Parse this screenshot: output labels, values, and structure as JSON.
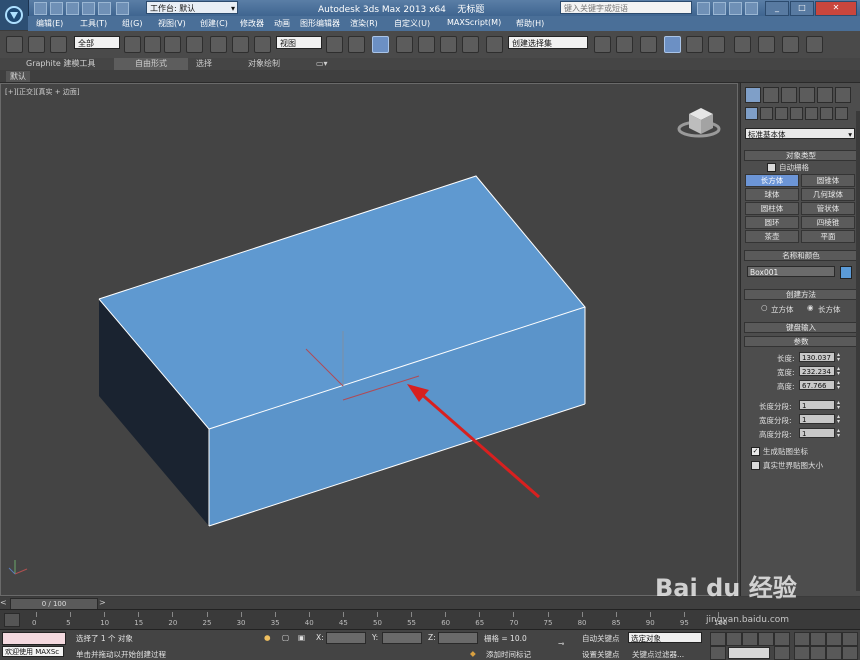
{
  "titlebar": {
    "workspace_prefix": "工作台:",
    "workspace_value": "默认",
    "app_title": "Autodesk 3ds Max  2013 x64",
    "file_name": "无标题",
    "search_placeholder": "键入关键字或短语"
  },
  "menu": {
    "items": [
      "编辑(E)",
      "工具(T)",
      "组(G)",
      "视图(V)",
      "创建(C)",
      "修改器",
      "动画",
      "图形编辑器",
      "渲染(R)",
      "自定义(U)",
      "MAXScript(M)",
      "帮助(H)"
    ]
  },
  "toolbar": {
    "filter_value": "全部",
    "coord_value": "视图",
    "selection_set": "创建选择集"
  },
  "ribbon": {
    "tabs": [
      "Graphite 建模工具",
      "自由形式",
      "选择",
      "对象绘制"
    ],
    "sub_label": "默认"
  },
  "viewport": {
    "label_parts": [
      "[+]",
      "[正交]",
      "[真实 + 边面]"
    ]
  },
  "cmdpanel": {
    "category": "标准基本体",
    "object_type": {
      "title": "对象类型",
      "autogrid": "自动栅格",
      "buttons": [
        "长方体",
        "圆锥体",
        "球体",
        "几何球体",
        "圆柱体",
        "管状体",
        "圆环",
        "四棱锥",
        "茶壶",
        "平面"
      ]
    },
    "name_color": {
      "title": "名称和颜色",
      "name": "Box001",
      "color": "#5b9bd8"
    },
    "creation_method": {
      "title": "创建方法",
      "options": [
        "立方体",
        "长方体"
      ]
    },
    "keyboard_entry": "键盘输入",
    "params": {
      "title": "参数",
      "length_label": "长度:",
      "length": "130.037",
      "width_label": "宽度:",
      "width": "232.234",
      "height_label": "高度:",
      "height": "67.766",
      "lseg_label": "长度分段:",
      "lseg": "1",
      "wseg_label": "宽度分段:",
      "wseg": "1",
      "hseg_label": "高度分段:",
      "hseg": "1",
      "gen_map": "生成贴图坐标",
      "real_world": "真实世界贴图大小"
    }
  },
  "timeline": {
    "frame_counter": "0 / 100",
    "ticks": [
      "0",
      "5",
      "10",
      "15",
      "20",
      "25",
      "30",
      "35",
      "40",
      "45",
      "50",
      "55",
      "60",
      "65",
      "70",
      "75",
      "80",
      "85",
      "90",
      "95",
      "100"
    ]
  },
  "status": {
    "welcome": "欢迎使用 MAXSc",
    "selected": "选择了 1 个 对象",
    "prompt": "单击并拖动以开始创建过程",
    "x_label": "X:",
    "y_label": "Y:",
    "z_label": "Z:",
    "grid": "栅格 = 10.0",
    "add_time_tag": "添加时间标记",
    "auto_key": "自动关键点",
    "set_key": "设置关键点",
    "selected_obj": "选定对象",
    "key_filters": "关键点过滤器..."
  },
  "watermark": {
    "logo_text": "Bai du 经验",
    "url": "jingyan.baidu.com"
  },
  "colors": {
    "box_top": "#5f99d0",
    "box_front": "#5b94ca",
    "box_side": "#1a2330",
    "accent": "#6c95d6"
  }
}
